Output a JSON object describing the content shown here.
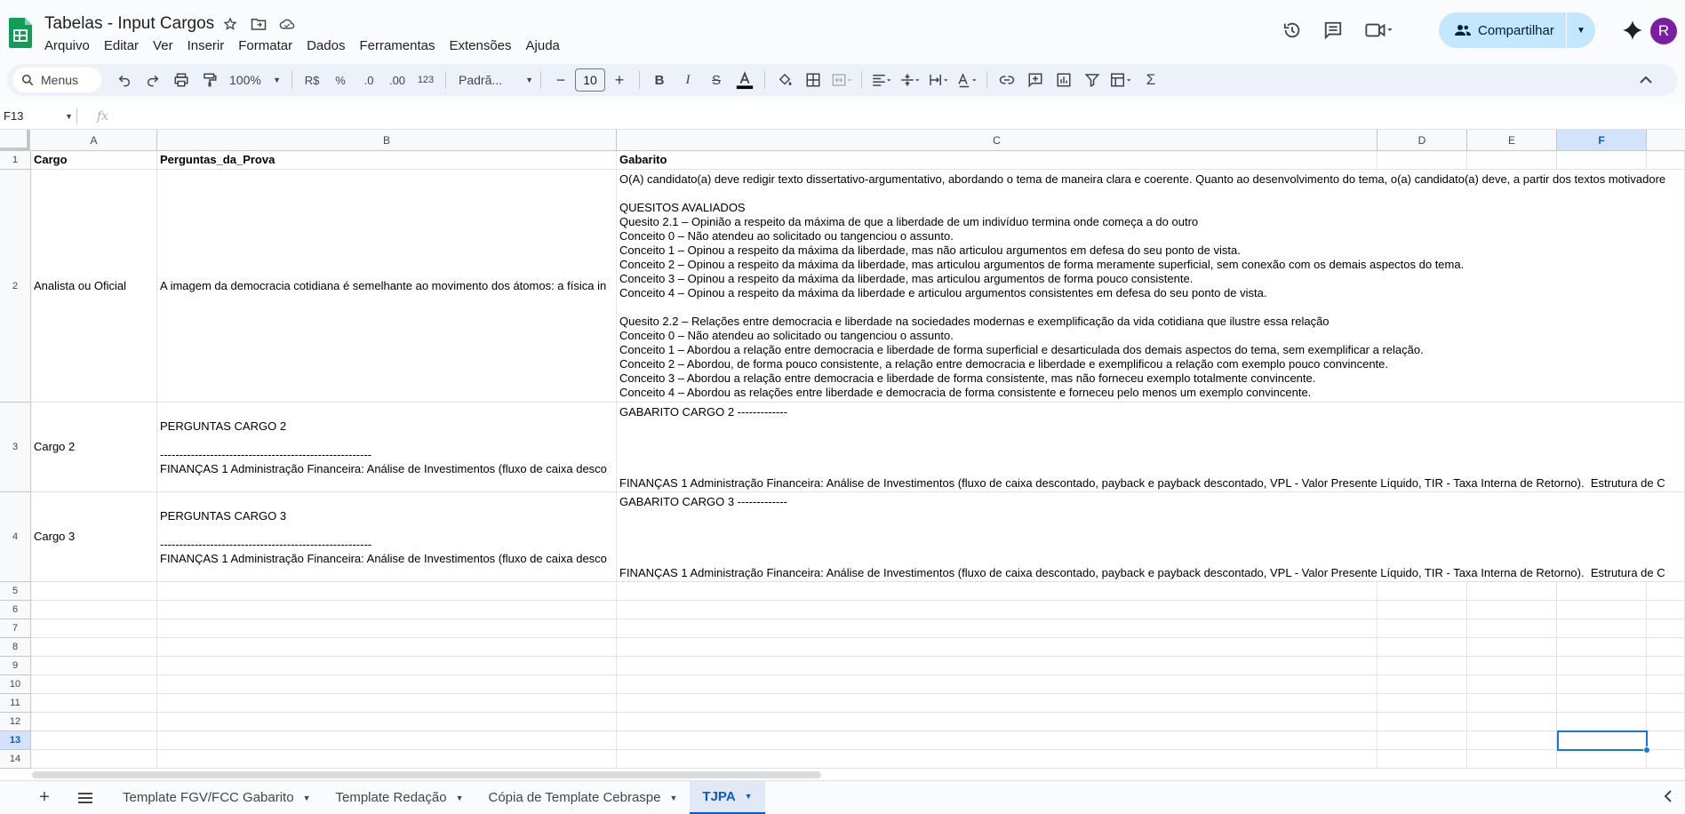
{
  "app": {
    "title": "Tabelas - Input Cargos",
    "avatar_letter": "R",
    "share_label": "Compartilhar"
  },
  "menu": [
    "Arquivo",
    "Editar",
    "Ver",
    "Inserir",
    "Formatar",
    "Dados",
    "Ferramentas",
    "Extensões",
    "Ajuda"
  ],
  "toolbar": {
    "search_label": "Menus",
    "zoom": "100%",
    "currency": "R$",
    "percent": "%",
    "dec_decrease": ".0",
    "dec_increase": ".00",
    "number_format": "123",
    "font": "Padrã...",
    "font_size": "10"
  },
  "formula_bar": {
    "name_box": "F13",
    "fx_label": "fx",
    "formula": ""
  },
  "columns": [
    "A",
    "B",
    "C",
    "D",
    "E",
    "F"
  ],
  "selected_column": "F",
  "row_numbers": [
    "1",
    "2",
    "3",
    "4",
    "5",
    "6",
    "7",
    "8",
    "9",
    "10",
    "11",
    "12",
    "13",
    "14"
  ],
  "selected_row": "13",
  "cells": {
    "a1": "Cargo",
    "b1": "Perguntas_da_Prova",
    "c1": "Gabarito",
    "a2": "Analista ou Oficial",
    "b2": "A imagem da democracia cotidiana é semelhante ao movimento dos átomos: a física in",
    "c2": "O(A) candidato(a) deve redigir texto dissertativo-argumentativo, abordando o tema de maneira clara e coerente. Quanto ao desenvolvimento do tema, o(a) candidato(a) deve, a partir dos textos motivadore\n\nQUESITOS AVALIADOS\nQuesito 2.1 – Opinião a respeito da máxima de que a liberdade de um indivíduo termina onde começa a do outro\nConceito 0 – Não atendeu ao solicitado ou tangenciou o assunto.\nConceito 1 – Opinou a respeito da máxima da liberdade, mas não articulou argumentos em defesa do seu ponto de vista.\nConceito 2 – Opinou a respeito da máxima da liberdade, mas articulou argumentos de forma meramente superficial, sem conexão com os demais aspectos do tema.\nConceito 3 – Opinou a respeito da máxima da liberdade, mas articulou argumentos de forma pouco consistente.\nConceito 4 – Opinou a respeito da máxima da liberdade e articulou argumentos consistentes em defesa do seu ponto de vista.\n\nQuesito 2.2 – Relações entre democracia e liberdade na sociedades modernas e exemplificação da vida cotidiana que ilustre essa relação\nConceito 0 – Não atendeu ao solicitado ou tangenciou o assunto.\nConceito 1 – Abordou a relação entre democracia e liberdade de forma superficial e desarticulada dos demais aspectos do tema, sem exemplificar a relação.\nConceito 2 – Abordou, de forma pouco consistente, a relação entre democracia e liberdade e exemplificou a relação com exemplo pouco convincente.\nConceito 3 – Abordou a relação entre democracia e liberdade de forma consistente, mas não forneceu exemplo totalmente convincente.\nConceito 4 – Abordou as relações entre liberdade e democracia de forma consistente e forneceu pelo menos um exemplo convincente.",
    "a3": "Cargo 2",
    "b3": "PERGUNTAS CARGO 2\n\n-------------------------------------------------------\nFINANÇAS 1 Administração Financeira: Análise de Investimentos (fluxo de caixa desco",
    "c3": "GABARITO CARGO 2 -------------\n\n\n\n\nFINANÇAS 1 Administração Financeira: Análise de Investimentos (fluxo de caixa descontado, payback e payback descontado, VPL - Valor Presente Líquido, TIR - Taxa Interna de Retorno).  Estrutura de C",
    "a4": "Cargo 3",
    "b4": "PERGUNTAS CARGO 3\n\n-------------------------------------------------------\nFINANÇAS 1 Administração Financeira: Análise de Investimentos (fluxo de caixa desco",
    "c4": "GABARITO CARGO 3 -------------\n\n\n\n\nFINANÇAS 1 Administração Financeira: Análise de Investimentos (fluxo de caixa descontado, payback e payback descontado, VPL - Valor Presente Líquido, TIR - Taxa Interna de Retorno).  Estrutura de C"
  },
  "sheets": [
    {
      "label": "Template FGV/FCC Gabarito",
      "active": false
    },
    {
      "label": "Template Redação",
      "active": false
    },
    {
      "label": "Cópia de Template Cebraspe",
      "active": false
    },
    {
      "label": "TJPA",
      "active": true
    }
  ],
  "colors": {
    "accent": "#0b57d0",
    "share_bg": "#c2e7ff",
    "selection": "#1a73e8",
    "logo_green": "#0f9d58"
  }
}
